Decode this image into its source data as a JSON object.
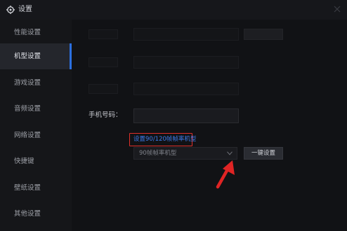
{
  "window": {
    "title": "设置",
    "title_icon": "gear-icon",
    "close_icon": "close-icon"
  },
  "sidebar": {
    "items": [
      {
        "label": "性能设置",
        "active": false
      },
      {
        "label": "机型设置",
        "active": true
      },
      {
        "label": "游戏设置",
        "active": false
      },
      {
        "label": "音频设置",
        "active": false
      },
      {
        "label": "网络设置",
        "active": false
      },
      {
        "label": "快捷键",
        "active": false
      },
      {
        "label": "壁纸设置",
        "active": false
      },
      {
        "label": "其他设置",
        "active": false
      }
    ]
  },
  "main": {
    "phone_label": "手机号码：",
    "phone_value": "",
    "link_text": "设置90/120帧帧率机型",
    "model_select": {
      "selected": "90帧帧率机型"
    },
    "action_button": "一键设置"
  },
  "colors": {
    "accent": "#2b6fe0",
    "link": "#3d7bea",
    "highlight_box": "#e0302a",
    "arrow": "#e02424"
  }
}
